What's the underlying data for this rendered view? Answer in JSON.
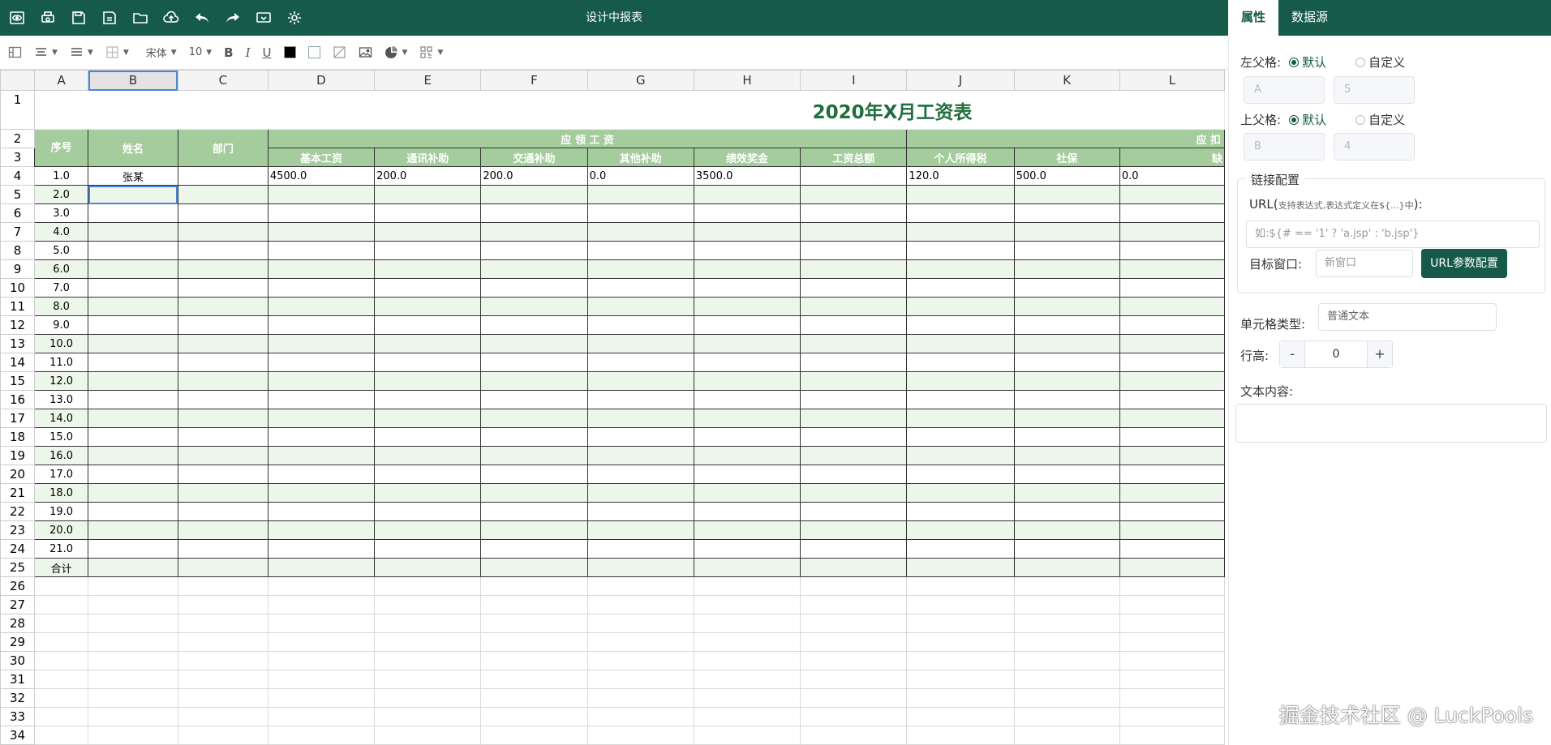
{
  "topbar": {
    "title": "设计中报表"
  },
  "toolbar_icons": [
    "preview-icon",
    "print-icon",
    "save-icon",
    "save-as-icon",
    "open-folder-icon",
    "upload-icon",
    "undo-icon",
    "redo-icon",
    "preview-window-icon",
    "settings-icon"
  ],
  "format": {
    "font": "宋体",
    "size": "10",
    "bold": "B",
    "italic": "I",
    "underline": "U"
  },
  "columns": [
    "A",
    "B",
    "C",
    "D",
    "E",
    "F",
    "G",
    "H",
    "I",
    "J",
    "K",
    "L"
  ],
  "sheet": {
    "title": "2020年X月工资表",
    "h_seq": "序号",
    "h_name": "姓名",
    "h_dept": "部门",
    "group_pay": "应 领 工 资",
    "group_deduct": "应 扣",
    "sub_headers": [
      "基本工资",
      "通讯补助",
      "交通补助",
      "其他补助",
      "绩效奖金",
      "工资总额",
      "个人所得税",
      "社保",
      "缺"
    ],
    "first_row": {
      "seq": "1.0",
      "name": "张某",
      "values": [
        "4500.0",
        "200.0",
        "200.0",
        "0.0",
        "3500.0",
        "",
        "120.0",
        "500.0",
        "0.0"
      ]
    },
    "seqs": [
      "2.0",
      "3.0",
      "4.0",
      "5.0",
      "6.0",
      "7.0",
      "8.0",
      "9.0",
      "10.0",
      "11.0",
      "12.0",
      "13.0",
      "14.0",
      "15.0",
      "16.0",
      "17.0",
      "18.0",
      "19.0",
      "20.0",
      "21.0"
    ],
    "total": "合计"
  },
  "right_panel": {
    "tab_props": "属性",
    "tab_datasource": "数据源",
    "left_parent": "左父格:",
    "top_parent": "上父格:",
    "opt_default": "默认",
    "opt_custom": "自定义",
    "lp_default": "A",
    "lp_custom": "5",
    "tp_default": "B",
    "tp_custom": "4",
    "link_legend": "链接配置",
    "url_label": "URL(",
    "url_hint": "支持表达式,表达式定义在${...}中",
    "url_close": "):",
    "url_placeholder": "如:${# == '1' ? 'a.jsp' : 'b.jsp'}",
    "target_label": "目标窗口:",
    "target_value": "新窗口",
    "url_param_button": "URL参数配置",
    "cell_type_label": "单元格类型:",
    "cell_type_value": "普通文本",
    "row_height_label": "行高:",
    "row_height_value": "0",
    "minus": "-",
    "plus": "+",
    "text_content_label": "文本内容:"
  },
  "watermark": "掘金技术社区 @ LuckPools"
}
